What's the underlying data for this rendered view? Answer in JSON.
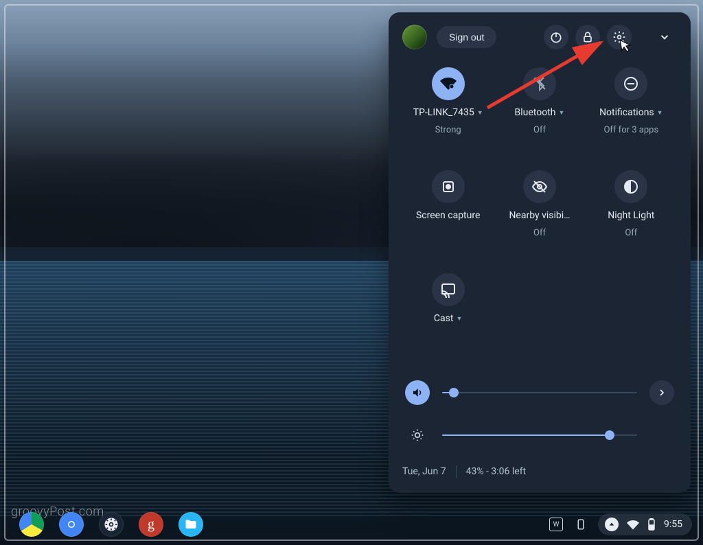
{
  "header": {
    "sign_out_label": "Sign out"
  },
  "tiles": {
    "wifi": {
      "label": "TP-LINK_7435",
      "sub": "Strong"
    },
    "bluetooth": {
      "label": "Bluetooth",
      "sub": "Off"
    },
    "notifications": {
      "label": "Notifications",
      "sub": "Off for 3 apps"
    },
    "screencap": {
      "label": "Screen capture",
      "sub": ""
    },
    "nearby": {
      "label": "Nearby visibi…",
      "sub": "Off"
    },
    "nightlight": {
      "label": "Night Light",
      "sub": "Off"
    },
    "cast": {
      "label": "Cast",
      "sub": ""
    }
  },
  "sliders": {
    "volume_pct": 6,
    "brightness_pct": 86
  },
  "footer": {
    "date": "Tue, Jun 7",
    "battery": "43% - 3:06 left"
  },
  "shelf": {
    "ime": "W",
    "clock": "9:55"
  },
  "watermark": "groovyPost.com"
}
